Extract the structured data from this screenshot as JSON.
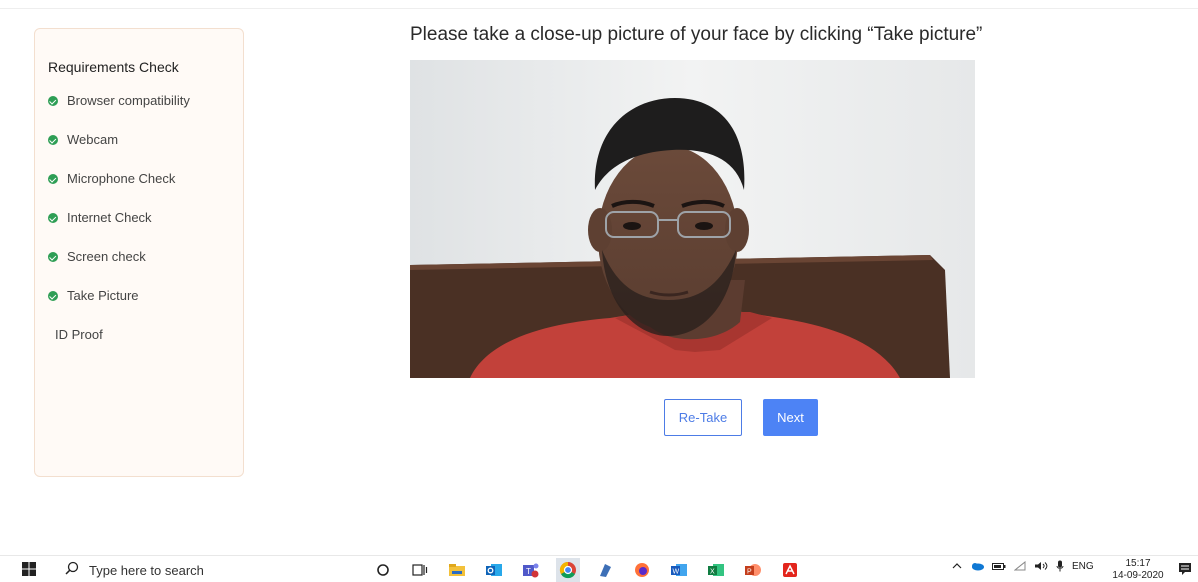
{
  "sidebar": {
    "title": "Requirements Check",
    "items": [
      {
        "label": "Browser compatibility",
        "done": true
      },
      {
        "label": "Webcam",
        "done": true
      },
      {
        "label": "Microphone Check",
        "done": true
      },
      {
        "label": "Internet Check",
        "done": true
      },
      {
        "label": "Screen check",
        "done": true
      },
      {
        "label": "Take Picture",
        "done": true
      },
      {
        "label": "ID Proof",
        "done": false
      }
    ]
  },
  "main": {
    "instruction": "Please take a close-up picture of your face by clicking “Take picture”",
    "retake_label": "Re-Take",
    "next_label": "Next"
  },
  "taskbar": {
    "search_placeholder": "Type here to search",
    "pinned": [
      "cortana-icon",
      "task-view-icon",
      "file-explorer-icon",
      "outlook-icon",
      "teams-icon",
      "chrome-icon",
      "app-icon",
      "firefox-icon",
      "word-icon",
      "excel-icon",
      "powerpoint-icon",
      "acrobat-icon"
    ],
    "tray": {
      "language": "ENG",
      "time": "15:17",
      "date": "14-09-2020"
    }
  },
  "colors": {
    "accent": "#4d83f5",
    "check_green": "#2e9e55",
    "sidebar_bg": "#fffaf6"
  }
}
